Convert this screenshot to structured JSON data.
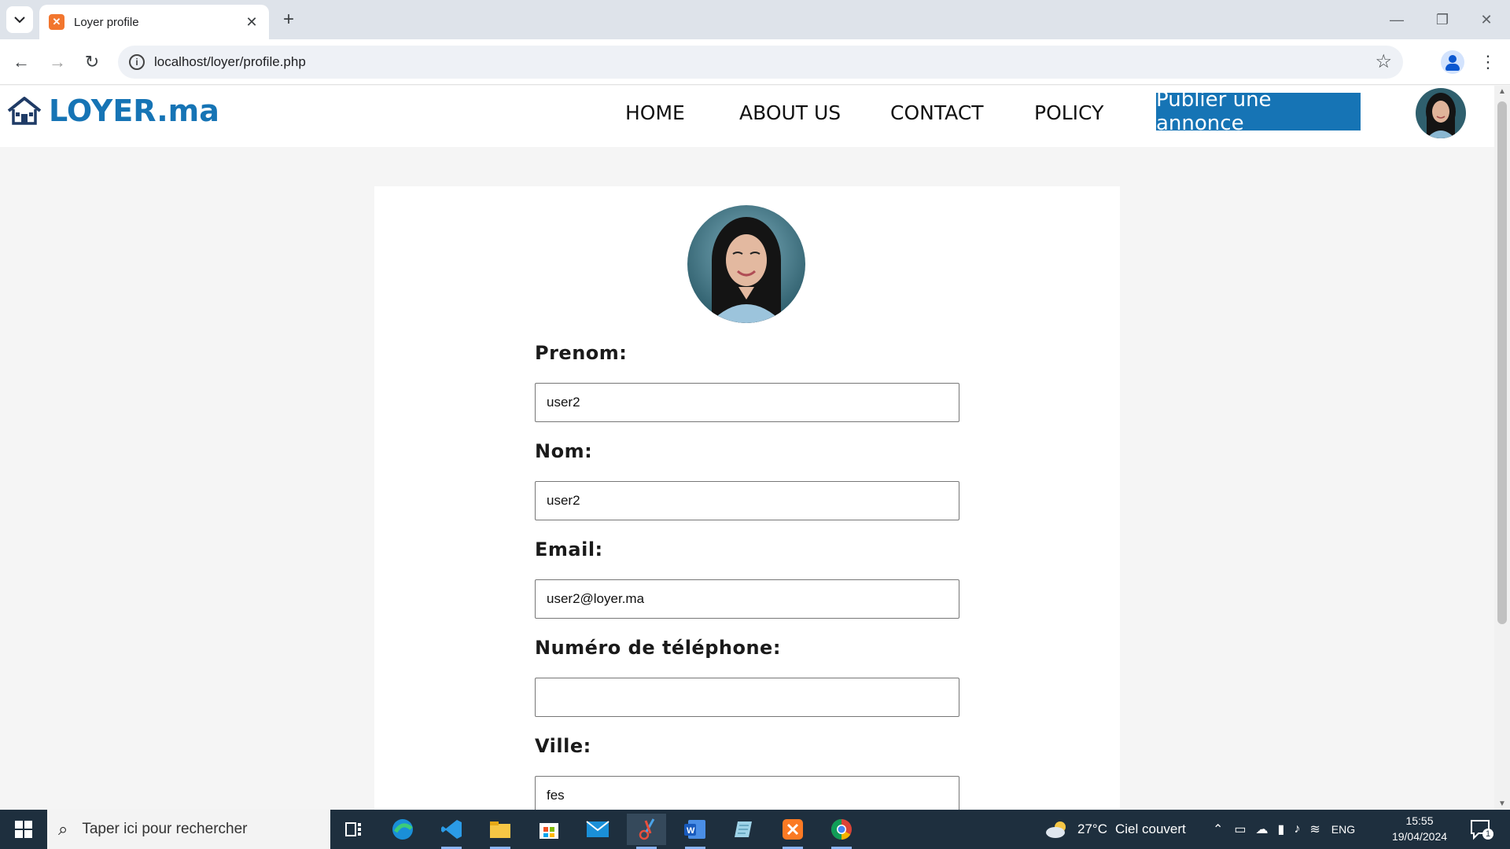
{
  "browser": {
    "tab_title": "Loyer profile",
    "favicon_text": "✕",
    "url": "localhost/loyer/profile.php"
  },
  "site": {
    "brand": "LOYER.ma",
    "brand_color": "#1674b5",
    "nav": [
      {
        "label": "HOME"
      },
      {
        "label": "ABOUT US"
      },
      {
        "label": "CONTACT"
      },
      {
        "label": "POLICY"
      }
    ],
    "publish_label": "Publier une annonce"
  },
  "form": {
    "prenom_label": "Prenom:",
    "prenom_value": "user2",
    "nom_label": "Nom:",
    "nom_value": "user2",
    "email_label": "Email:",
    "email_value": "user2@loyer.ma",
    "phone_label": "Numéro de téléphone:",
    "phone_value": "",
    "ville_label": "Ville:",
    "ville_value": "fes"
  },
  "taskbar": {
    "search_placeholder": "Taper ici pour rechercher",
    "weather_temp": "27°C",
    "weather_text": "Ciel couvert",
    "language": "ENG",
    "time": "15:55",
    "date": "19/04/2024",
    "notification_count": "1"
  }
}
